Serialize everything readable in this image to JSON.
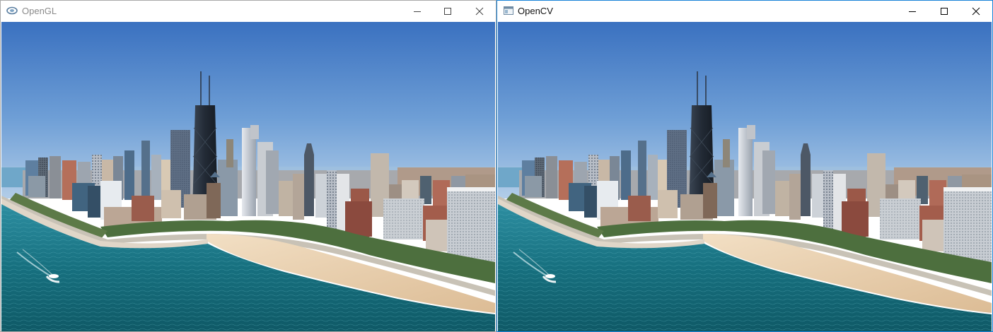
{
  "windows": [
    {
      "title": "OpenGL",
      "app_icon": "opengl-logo-icon",
      "controls": {
        "minimize": "minimize-icon",
        "maximize": "maximize-icon",
        "close": "close-icon"
      },
      "content": "chicago-skyline-photo"
    },
    {
      "title": "OpenCV",
      "app_icon": "opencv-window-icon",
      "controls": {
        "minimize": "minimize-icon",
        "maximize": "maximize-icon",
        "close": "close-icon"
      },
      "content": "chicago-skyline-photo"
    }
  ],
  "colors": {
    "sky_top": "#3f76c2",
    "sky_horizon": "#a9c8e6",
    "water": "#1a7d8a",
    "sand": "#e8cfae",
    "tower": "#2a3340",
    "active_border": "#1883d7"
  }
}
